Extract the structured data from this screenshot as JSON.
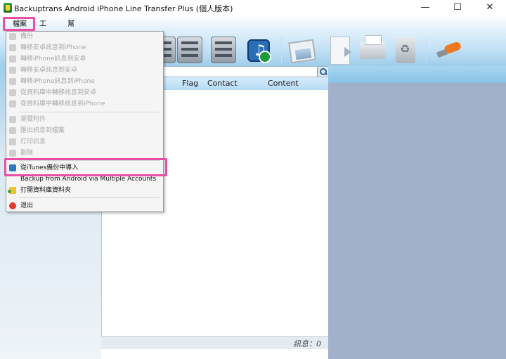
{
  "window": {
    "title": "Backuptrans Android iPhone Line Transfer Plus (個人版本)",
    "minimize_glyph": "—",
    "maximize_glyph": "☐",
    "close_glyph": "✕"
  },
  "menubar": {
    "file_label": "檔案",
    "tools_label": "工具",
    "help_label": "幫助"
  },
  "toolbar": {
    "icons": [
      "server-icon",
      "server-icon",
      "server-icon",
      "itunes-import-icon",
      "photo-icon",
      "export-doc-icon",
      "printer-icon",
      "recycle-bin-icon",
      "key-icon"
    ]
  },
  "table": {
    "columns": [
      "Flag",
      "Contact",
      "Content"
    ]
  },
  "status": {
    "text": "訊息：0"
  },
  "file_menu": {
    "items": [
      {
        "label": "備份",
        "enabled": false,
        "icon": "backup-icon"
      },
      {
        "label": "轉移安卓訊息到iPhone",
        "enabled": false,
        "icon": "phone-transfer-icon"
      },
      {
        "label": "轉移iPhone訊息到安卓",
        "enabled": false,
        "icon": "phone-transfer-icon"
      },
      {
        "label": "轉移安卓訊息到安卓",
        "enabled": false,
        "icon": "phone-transfer-icon"
      },
      {
        "label": "轉移iPhone訊息到iPhone",
        "enabled": false,
        "icon": "phone-transfer-icon"
      },
      {
        "label": "從資料庫中轉移訊息到安卓",
        "enabled": false,
        "icon": "database-transfer-icon"
      },
      {
        "label": "從資料庫中轉移訊息到iPhone",
        "enabled": false,
        "icon": "database-transfer-icon"
      },
      {
        "label": "瀏覽附件",
        "enabled": false,
        "icon": "attachment-icon"
      },
      {
        "label": "匯出訊息到檔案",
        "enabled": false,
        "icon": "export-icon"
      },
      {
        "label": "打印訊息",
        "enabled": false,
        "icon": "print-icon"
      },
      {
        "label": "刪除",
        "enabled": false,
        "icon": "delete-icon"
      },
      {
        "label": "從iTunes備份中導入",
        "enabled": true,
        "icon": "itunes-icon"
      },
      {
        "label": "Backup from Android via Multiple Accounts",
        "enabled": true,
        "icon": ""
      },
      {
        "label": "打開資料庫資料夾",
        "enabled": true,
        "icon": "folder-icon"
      },
      {
        "label": "退出",
        "enabled": true,
        "icon": "exit-icon"
      }
    ]
  },
  "colors": {
    "highlight": "#ea4fa8",
    "right_pane": "#a1b1c9",
    "toolbar_gradient_end": "#9fcde9"
  }
}
